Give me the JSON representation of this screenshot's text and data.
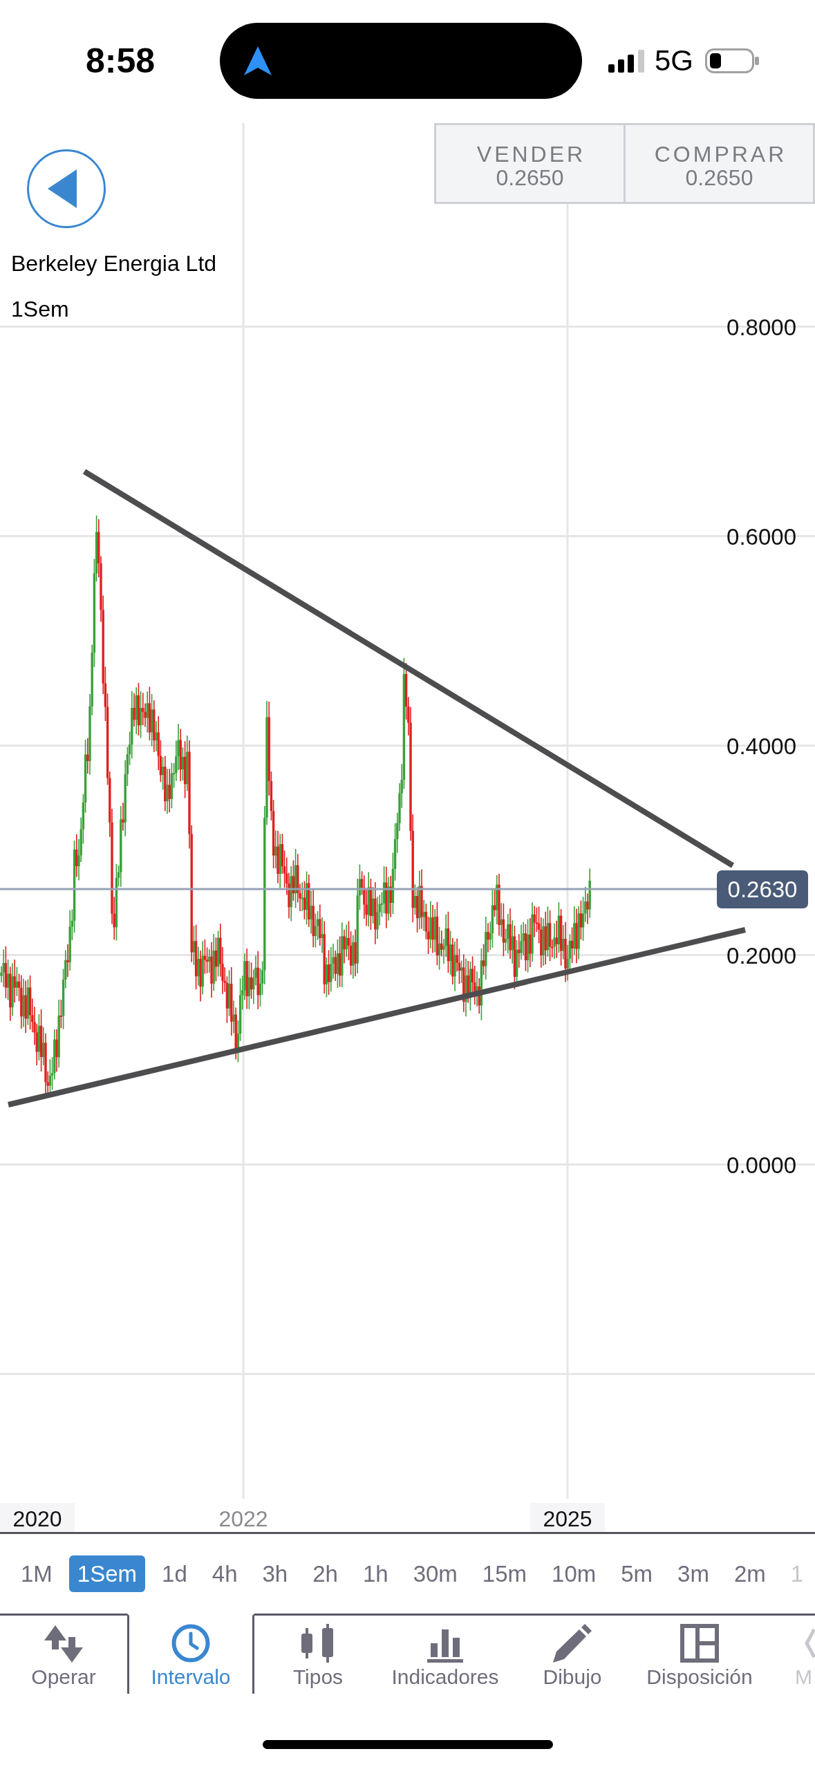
{
  "status_bar": {
    "time": "8:58",
    "network": "5G"
  },
  "instrument": {
    "name": "Berkeley Energia Ltd",
    "interval": "1Sem"
  },
  "quote_buttons": [
    {
      "label": "VENDER",
      "price": "0.2650"
    },
    {
      "label": "COMPRAR",
      "price": "0.2650"
    }
  ],
  "chart": {
    "y_axis_labels": [
      "0.8000",
      "0.6000",
      "0.4000",
      "0.2000",
      "0.0000"
    ],
    "x_axis_labels": [
      {
        "text": "2020",
        "emphasized": true
      },
      {
        "text": "2022",
        "emphasized": false
      },
      {
        "text": "2025",
        "emphasized": true
      }
    ],
    "last_price": "0.2630"
  },
  "intervals": [
    {
      "label": "1M",
      "selected": false
    },
    {
      "label": "1Sem",
      "selected": true
    },
    {
      "label": "1d",
      "selected": false
    },
    {
      "label": "4h",
      "selected": false
    },
    {
      "label": "3h",
      "selected": false
    },
    {
      "label": "2h",
      "selected": false
    },
    {
      "label": "1h",
      "selected": false
    },
    {
      "label": "30m",
      "selected": false
    },
    {
      "label": "15m",
      "selected": false
    },
    {
      "label": "10m",
      "selected": false
    },
    {
      "label": "5m",
      "selected": false
    },
    {
      "label": "3m",
      "selected": false
    },
    {
      "label": "2m",
      "selected": false
    },
    {
      "label": "1",
      "selected": false
    }
  ],
  "toolbar": [
    {
      "label": "Operar",
      "kind": "arrows",
      "selected": false
    },
    {
      "label": "Intervalo",
      "kind": "clock",
      "selected": true
    },
    {
      "label": "Tipos",
      "kind": "candles",
      "selected": false
    },
    {
      "label": "Indicadores",
      "kind": "bars",
      "selected": false
    },
    {
      "label": "Dibujo",
      "kind": "pencil",
      "selected": false
    },
    {
      "label": "Disposición",
      "kind": "layout",
      "selected": false
    },
    {
      "label": "M",
      "kind": "chevron",
      "selected": false
    }
  ]
}
